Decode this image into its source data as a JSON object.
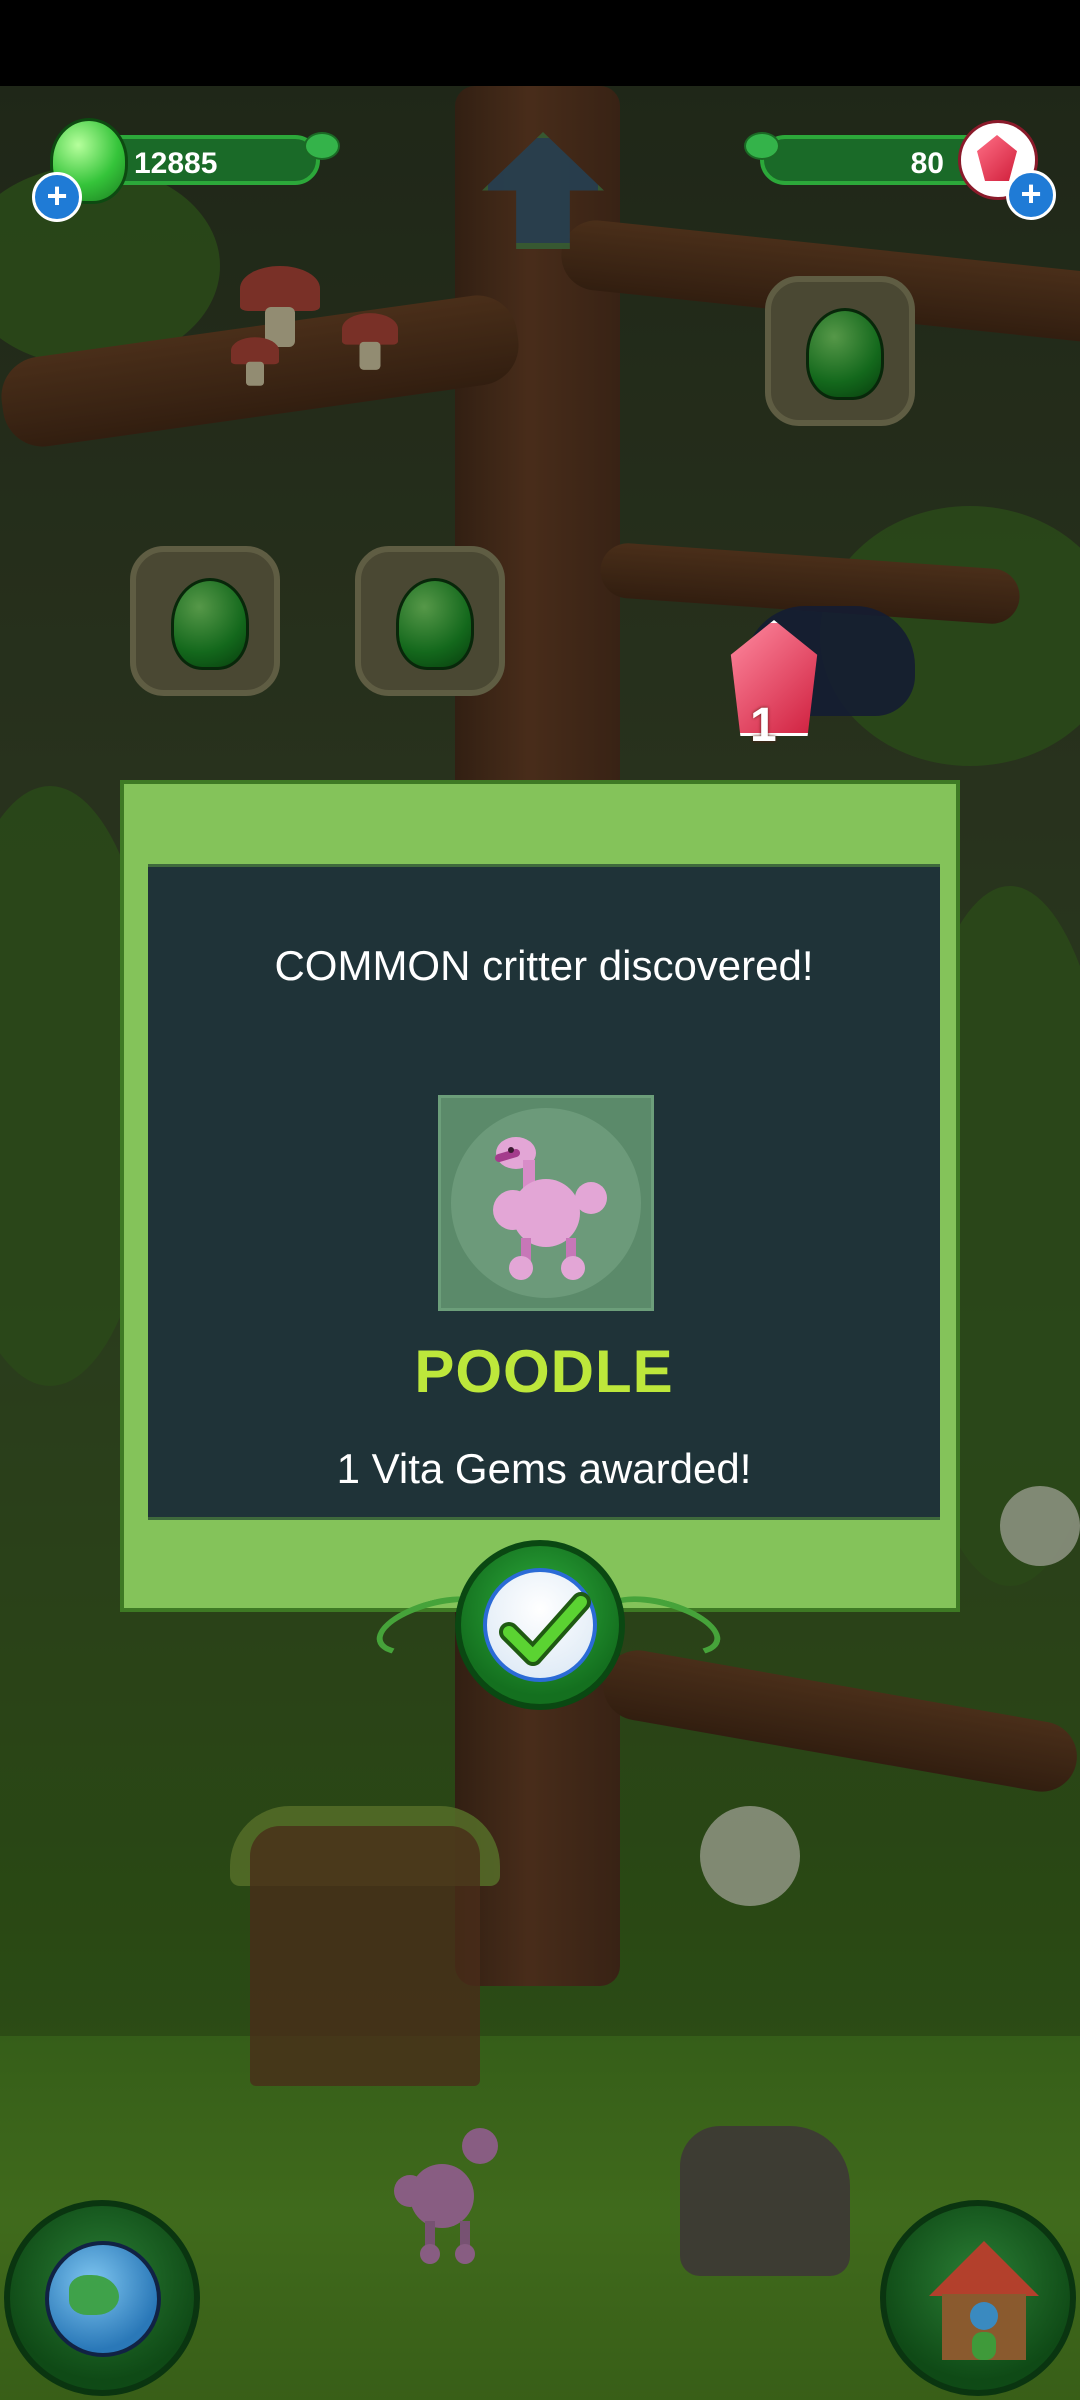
{
  "hud": {
    "goo_count": "12885",
    "gem_count": "80",
    "add_goo_label": "+",
    "add_gems_label": "+"
  },
  "scene": {
    "gem_drop_count": "1"
  },
  "modal": {
    "message": "COMMON critter discovered!",
    "critter_name": "POODLE",
    "award": "1 Vita Gems awarded!"
  },
  "icons": {
    "goo": "green-goo-icon",
    "gem": "red-vita-gem-icon",
    "confirm": "checkmark-icon",
    "world_map": "globe-icon",
    "home": "treehouse-icon",
    "up": "up-arrow-icon"
  },
  "colors": {
    "critter_name": "#bde73b",
    "panel_green": "#84c35a",
    "panel_dark": "#1f3338",
    "hud_green": "#1a6a28"
  }
}
